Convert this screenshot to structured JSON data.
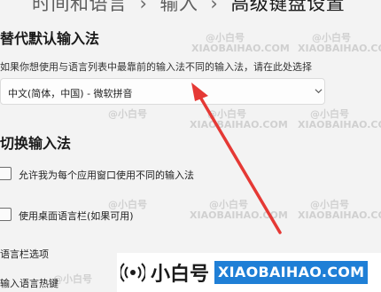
{
  "breadcrumb": {
    "parent": "时间和语言",
    "section": "输入",
    "current": "高级键盘设置",
    "separator": "›"
  },
  "override": {
    "heading": "替代默认输入法",
    "description": "如果你想使用与语言列表中最靠前的输入法不同的输入法，请在此处选择",
    "select_value": "中文(简体，中国) - 微软拼音"
  },
  "switch": {
    "heading": "切换输入法",
    "per_app_label": "允许我为每个应用窗口使用不同的输入法",
    "per_app_checked": false,
    "desktop_bar_label": "使用桌面语言栏(如果可用)",
    "desktop_bar_checked": false
  },
  "links": {
    "language_bar_options": "语言栏选项",
    "input_hotkeys": "输入语言热键"
  },
  "watermark": {
    "brand_cn": "小白号",
    "brand_en": "XIAOBAIHAO.COM",
    "small_cn": "@小白号",
    "small_en": "XIAOBAIHAO.COM"
  },
  "colors": {
    "background": "#f3f3f3",
    "arrow": "#e53935",
    "brand_blue": "#1f7fd6"
  }
}
